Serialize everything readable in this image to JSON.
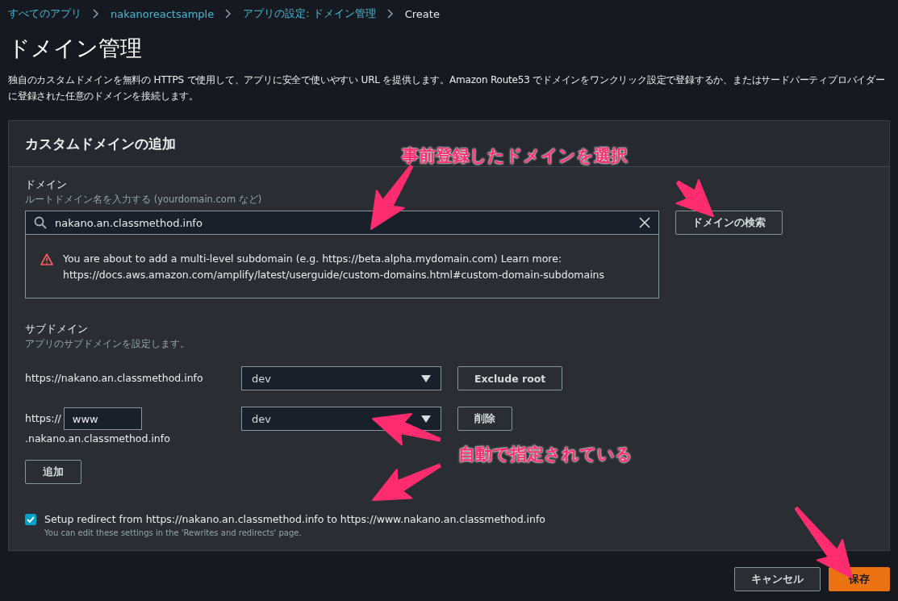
{
  "breadcrumbs": [
    {
      "label": "すべてのアプリ",
      "kind": "link"
    },
    {
      "label": "nakanoreactsample",
      "kind": "link"
    },
    {
      "label": "アプリの設定: ドメイン管理",
      "kind": "link"
    },
    {
      "label": "Create",
      "kind": "current"
    }
  ],
  "title": "ドメイン管理",
  "description": "独自のカスタムドメインを無料の HTTPS で使用して、アプリに安全で使いやすい URL を提供します。Amazon Route53 でドメインをワンクリック設定で登録するか、またはサードパーティプロバイダーに登録された任意のドメインを接続します。",
  "panel": {
    "heading": "カスタムドメインの追加",
    "domain": {
      "label": "ドメイン",
      "hint": "ルートドメイン名を入力する (yourdomain.com など)",
      "value": "nakano.an.classmethod.info",
      "button": "ドメインの検索",
      "warning": "You are about to add a multi-level subdomain (e.g. https://beta.alpha.mydomain.com) Learn more: https://docs.aws.amazon.com/amplify/latest/userguide/custom-domains.html#custom-domain-subdomains"
    },
    "subdomain": {
      "label": "サブドメイン",
      "hint": "アプリのサブドメインを設定します。",
      "rows": [
        {
          "kind": "root",
          "url": "https://nakano.an.classmethod.info",
          "branch": "dev",
          "button": "Exclude root"
        },
        {
          "kind": "prefix",
          "prefix": "https://",
          "value": "www",
          "suffix": ".nakano.an.classmethod.info",
          "branch": "dev",
          "button": "削除"
        }
      ],
      "add_button": "追加"
    },
    "redirect": {
      "checked": true,
      "label": "Setup redirect from https://nakano.an.classmethod.info to https://www.nakano.an.classmethod.info",
      "hint": "You can edit these settings in the 'Rewrites and redirects' page."
    }
  },
  "buttons": [
    {
      "label": "キャンセル",
      "kind": "secondary"
    },
    {
      "label": "保存",
      "kind": "primary"
    }
  ],
  "annotations": [
    {
      "text": "事前登録したドメインを選択"
    },
    {
      "text": "自動で指定されている"
    }
  ]
}
